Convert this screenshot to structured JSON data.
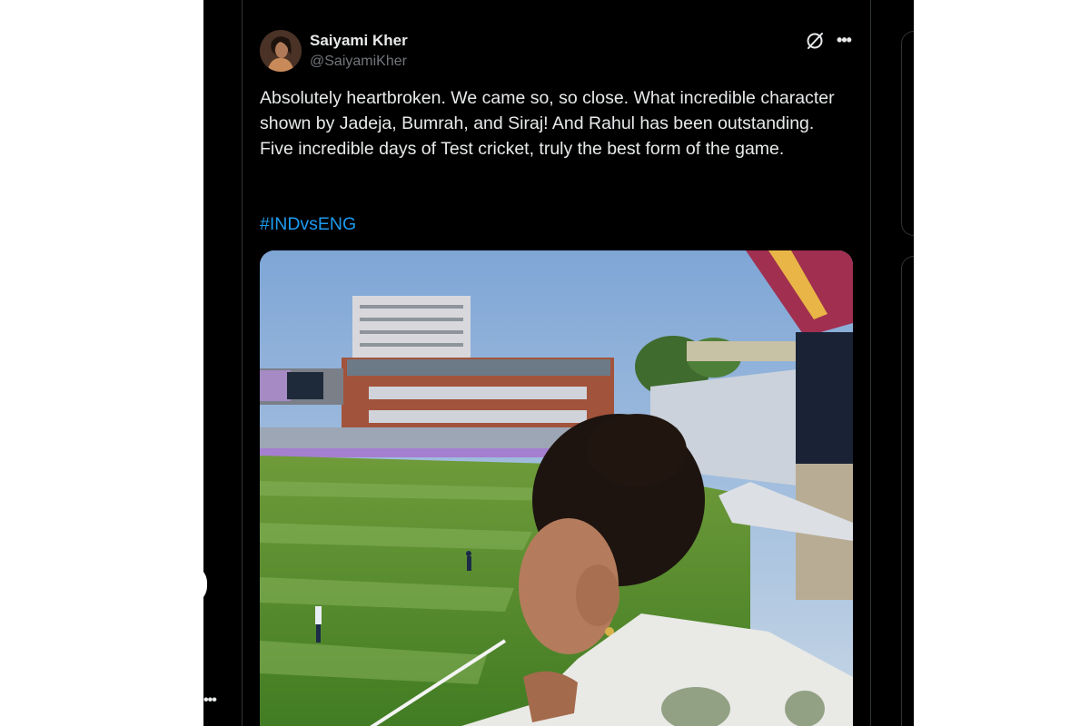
{
  "tweet": {
    "author": {
      "display_name": "Saiyami Kher",
      "handle": "@SaiyamiKher",
      "avatar_icon": "profile-photo"
    },
    "text": "Absolutely heartbroken. We came so, so close. What incredible character shown by Jadeja, Bumrah, and Siraj! And Rahul has been outstanding. Five incredible days of Test cricket, truly the best form of the game.",
    "hashtag": "#INDvsENG",
    "media": {
      "type": "photo",
      "icon": "photo-cricket-stadium"
    },
    "actions": {
      "grok_icon": "grok-icon",
      "more_icon": "more-options-icon",
      "more_glyph": "•••"
    }
  },
  "sidebar": {
    "more_glyph": "•••"
  },
  "colors": {
    "background": "#000000",
    "text_primary": "#e7e9ea",
    "text_secondary": "#71767b",
    "link": "#1d9bf0",
    "border": "#2f3336"
  }
}
